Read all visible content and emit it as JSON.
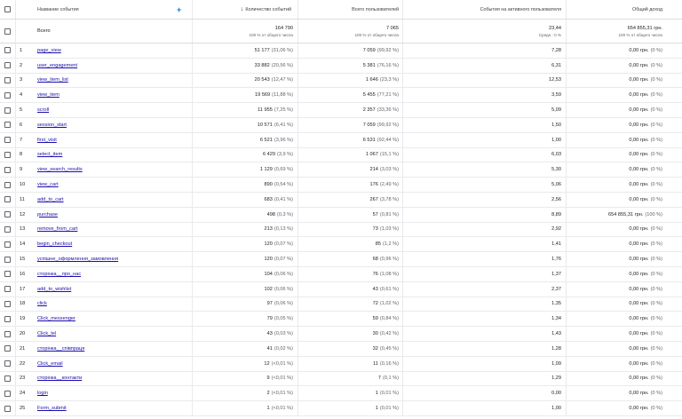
{
  "header": {
    "col_name": "Название события",
    "add_icon": "+",
    "col_events": "Количество событий",
    "sort_icon": "arrow-down-icon",
    "col_users": "Всего пользователей",
    "col_per_user": "События на активного пользователя",
    "col_revenue": "Общий доход"
  },
  "totals": {
    "label": "Всего",
    "events": "164 790",
    "events_sub": "100 % от общего числа",
    "users": "7 065",
    "users_sub": "100 % от общего числа",
    "per_user": "23,44",
    "per_user_sub": "Средн.: 0 %",
    "revenue": "654 855,31 грн.",
    "revenue_sub": "100 % от общего числа"
  },
  "rows": [
    {
      "n": "1",
      "name": "page_view",
      "events": "51 177",
      "events_pct": "(31,06 %)",
      "users": "7 059",
      "users_pct": "(99,92 %)",
      "per_user": "7,28",
      "revenue": "0,00 грн.",
      "revenue_pct": "(0 %)"
    },
    {
      "n": "2",
      "name": "user_engagement",
      "events": "33 882",
      "events_pct": "(20,56 %)",
      "users": "5 381",
      "users_pct": "(76,16 %)",
      "per_user": "6,31",
      "revenue": "0,00 грн.",
      "revenue_pct": "(0 %)"
    },
    {
      "n": "3",
      "name": "view_item_list",
      "events": "20 543",
      "events_pct": "(12,47 %)",
      "users": "1 646",
      "users_pct": "(23,3 %)",
      "per_user": "12,53",
      "revenue": "0,00 грн.",
      "revenue_pct": "(0 %)"
    },
    {
      "n": "4",
      "name": "view_item",
      "events": "19 569",
      "events_pct": "(11,88 %)",
      "users": "5 455",
      "users_pct": "(77,21 %)",
      "per_user": "3,59",
      "revenue": "0,00 грн.",
      "revenue_pct": "(0 %)"
    },
    {
      "n": "5",
      "name": "scroll",
      "events": "11 955",
      "events_pct": "(7,25 %)",
      "users": "2 357",
      "users_pct": "(33,36 %)",
      "per_user": "5,09",
      "revenue": "0,00 грн.",
      "revenue_pct": "(0 %)"
    },
    {
      "n": "6",
      "name": "session_start",
      "events": "10 571",
      "events_pct": "(6,41 %)",
      "users": "7 059",
      "users_pct": "(99,92 %)",
      "per_user": "1,50",
      "revenue": "0,00 грн.",
      "revenue_pct": "(0 %)"
    },
    {
      "n": "7",
      "name": "first_visit",
      "events": "6 521",
      "events_pct": "(3,96 %)",
      "users": "6 531",
      "users_pct": "(92,44 %)",
      "per_user": "1,00",
      "revenue": "0,00 грн.",
      "revenue_pct": "(0 %)"
    },
    {
      "n": "8",
      "name": "select_item",
      "events": "6 429",
      "events_pct": "(3,9 %)",
      "users": "1 067",
      "users_pct": "(15,1 %)",
      "per_user": "6,03",
      "revenue": "0,00 грн.",
      "revenue_pct": "(0 %)"
    },
    {
      "n": "9",
      "name": "view_search_results",
      "events": "1 129",
      "events_pct": "(0,69 %)",
      "users": "214",
      "users_pct": "(3,03 %)",
      "per_user": "5,30",
      "revenue": "0,00 грн.",
      "revenue_pct": "(0 %)"
    },
    {
      "n": "10",
      "name": "view_cart",
      "events": "890",
      "events_pct": "(0,54 %)",
      "users": "176",
      "users_pct": "(2,49 %)",
      "per_user": "5,06",
      "revenue": "0,00 грн.",
      "revenue_pct": "(0 %)"
    },
    {
      "n": "11",
      "name": "add_to_cart",
      "events": "683",
      "events_pct": "(0,41 %)",
      "users": "267",
      "users_pct": "(3,78 %)",
      "per_user": "2,56",
      "revenue": "0,00 грн.",
      "revenue_pct": "(0 %)"
    },
    {
      "n": "12",
      "name": "purchase",
      "events": "498",
      "events_pct": "(0,3 %)",
      "users": "57",
      "users_pct": "(0,81 %)",
      "per_user": "8,89",
      "revenue": "654 855,31 грн.",
      "revenue_pct": "(100 %)"
    },
    {
      "n": "13",
      "name": "remove_from_cart",
      "events": "213",
      "events_pct": "(0,13 %)",
      "users": "73",
      "users_pct": "(1,03 %)",
      "per_user": "2,92",
      "revenue": "0,00 грн.",
      "revenue_pct": "(0 %)"
    },
    {
      "n": "14",
      "name": "begin_checkout",
      "events": "120",
      "events_pct": "(0,07 %)",
      "users": "85",
      "users_pct": "(1,2 %)",
      "per_user": "1,41",
      "revenue": "0,00 грн.",
      "revenue_pct": "(0 %)"
    },
    {
      "n": "15",
      "name": "успішне_оформлення_замовлення",
      "events": "120",
      "events_pct": "(0,07 %)",
      "users": "68",
      "users_pct": "(0,96 %)",
      "per_user": "1,76",
      "revenue": "0,00 грн.",
      "revenue_pct": "(0 %)"
    },
    {
      "n": "16",
      "name": "сторінка__про_нас",
      "events": "104",
      "events_pct": "(0,06 %)",
      "users": "76",
      "users_pct": "(1,08 %)",
      "per_user": "1,37",
      "revenue": "0,00 грн.",
      "revenue_pct": "(0 %)"
    },
    {
      "n": "17",
      "name": "add_to_wishlist",
      "events": "102",
      "events_pct": "(0,06 %)",
      "users": "43",
      "users_pct": "(0,61 %)",
      "per_user": "2,37",
      "revenue": "0,00 грн.",
      "revenue_pct": "(0 %)"
    },
    {
      "n": "18",
      "name": "click",
      "events": "97",
      "events_pct": "(0,06 %)",
      "users": "72",
      "users_pct": "(1,02 %)",
      "per_user": "1,35",
      "revenue": "0,00 грн.",
      "revenue_pct": "(0 %)"
    },
    {
      "n": "19",
      "name": "Click_messenger",
      "events": "79",
      "events_pct": "(0,05 %)",
      "users": "59",
      "users_pct": "(0,84 %)",
      "per_user": "1,34",
      "revenue": "0,00 грн.",
      "revenue_pct": "(0 %)"
    },
    {
      "n": "20",
      "name": "Click_tel",
      "events": "43",
      "events_pct": "(0,03 %)",
      "users": "30",
      "users_pct": "(0,42 %)",
      "per_user": "1,43",
      "revenue": "0,00 грн.",
      "revenue_pct": "(0 %)"
    },
    {
      "n": "21",
      "name": "сторінка__співпраця",
      "events": "41",
      "events_pct": "(0,02 %)",
      "users": "32",
      "users_pct": "(0,45 %)",
      "per_user": "1,28",
      "revenue": "0,00 грн.",
      "revenue_pct": "(0 %)"
    },
    {
      "n": "22",
      "name": "Click_email",
      "events": "12",
      "events_pct": "(<0,01 %)",
      "users": "11",
      "users_pct": "(0,16 %)",
      "per_user": "1,09",
      "revenue": "0,00 грн.",
      "revenue_pct": "(0 %)"
    },
    {
      "n": "23",
      "name": "сторінка__контакти",
      "events": "9",
      "events_pct": "(<0,01 %)",
      "users": "7",
      "users_pct": "(0,1 %)",
      "per_user": "1,29",
      "revenue": "0,00 грн.",
      "revenue_pct": "(0 %)"
    },
    {
      "n": "24",
      "name": "login",
      "events": "2",
      "events_pct": "(<0,01 %)",
      "users": "1",
      "users_pct": "(0,01 %)",
      "per_user": "0,00",
      "revenue": "0,00 грн.",
      "revenue_pct": "(0 %)"
    },
    {
      "n": "25",
      "name": "Form_submit",
      "events": "1",
      "events_pct": "(<0,01 %)",
      "users": "1",
      "users_pct": "(0,01 %)",
      "per_user": "1,00",
      "revenue": "0,00 грн.",
      "revenue_pct": "(0 %)"
    }
  ]
}
